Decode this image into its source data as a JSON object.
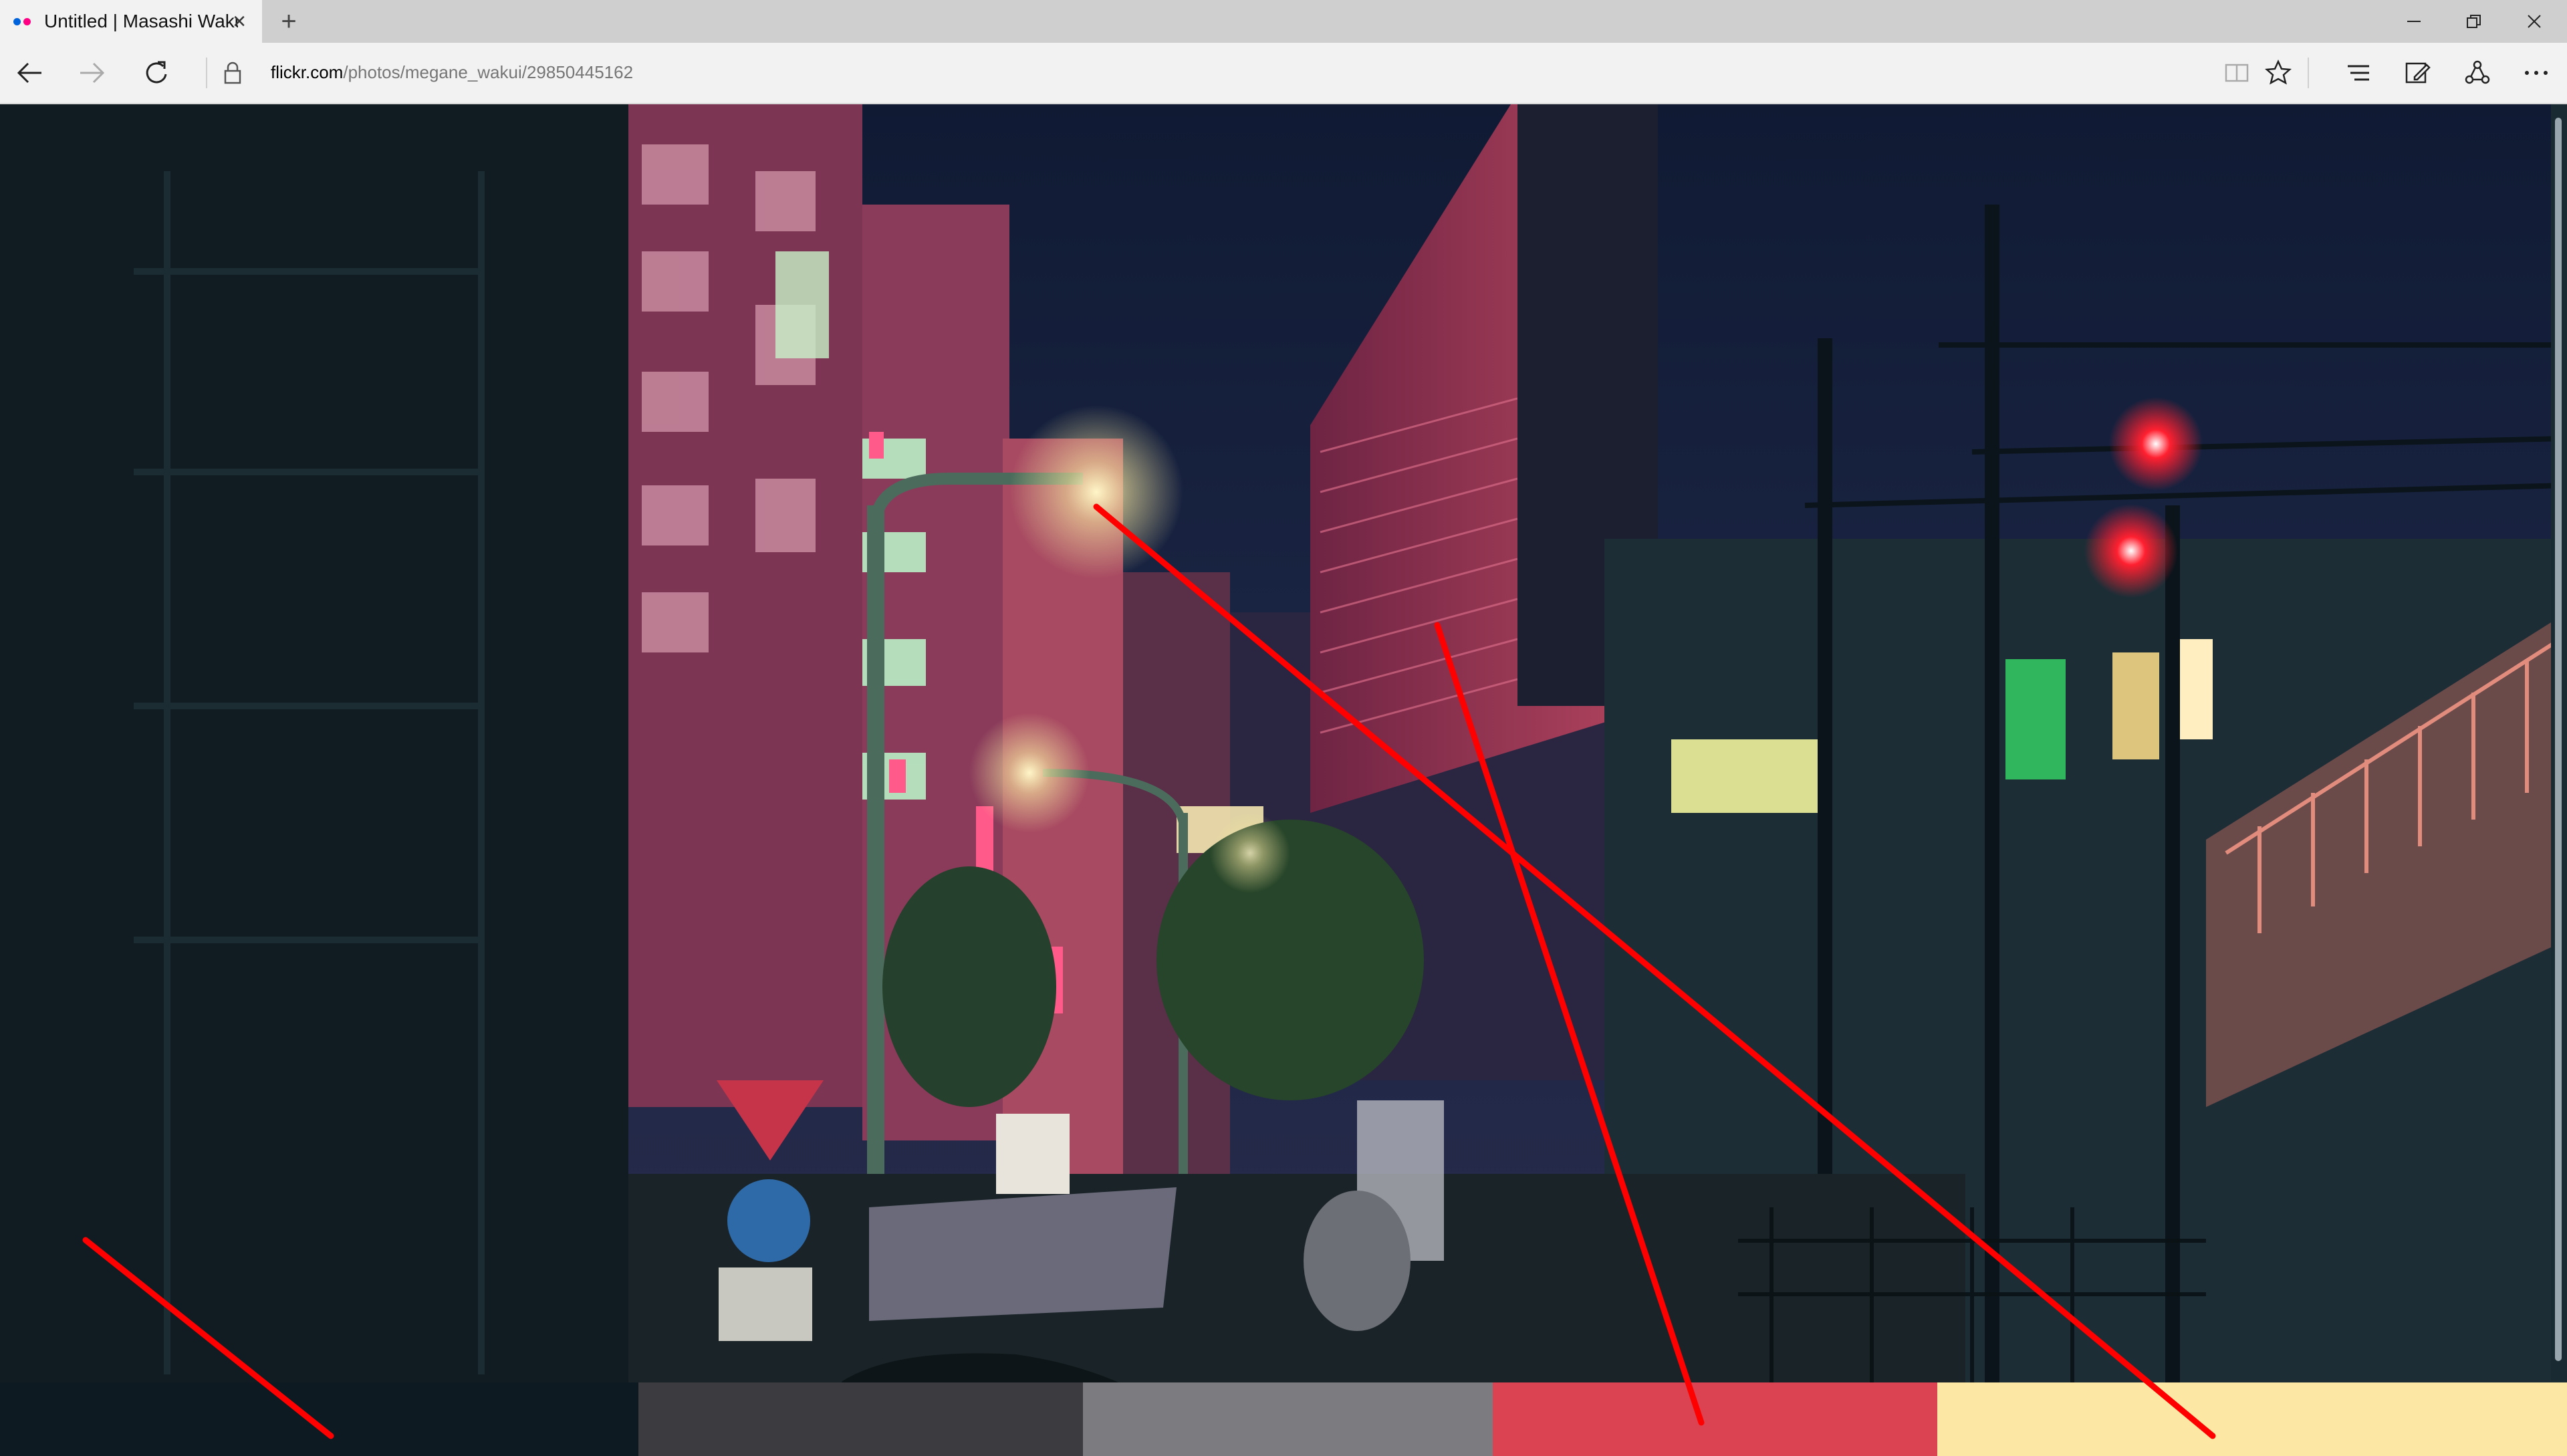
{
  "browser": {
    "tab": {
      "title": "Untitled | Masashi Wakui",
      "favicon_colors": [
        "#0063dc",
        "#ff0084"
      ]
    },
    "url": {
      "domain": "flickr.com",
      "path": "/photos/megane_wakui/29850445162"
    },
    "icons": {
      "back": "arrow-left-icon",
      "forward": "arrow-right-icon",
      "refresh": "refresh-icon",
      "lock": "lock-icon",
      "reading_view": "book-icon",
      "favorite": "star-icon",
      "hub": "hub-icon",
      "notes": "pen-icon",
      "share": "share-icon",
      "more": "more-icon",
      "minimize": "minimize-icon",
      "restore": "restore-icon",
      "close": "close-icon"
    }
  },
  "content": {
    "image_subject": "night city street with neon signs, streetlights, traffic signals and railway",
    "palette_colors": [
      "#0e1a22",
      "#3b3b40",
      "#7b7b80",
      "#dc4352",
      "#fde7a4"
    ],
    "annotation_color": "#ff0000"
  }
}
